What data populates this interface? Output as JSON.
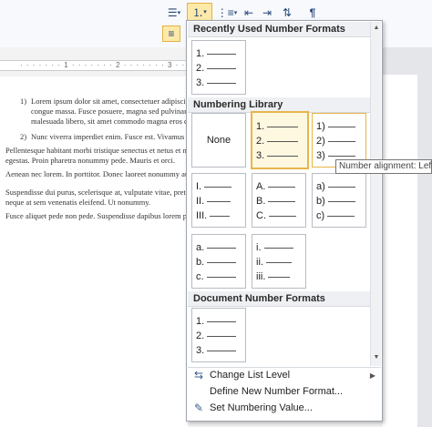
{
  "ribbon": {
    "bullets_icon": "bullets-icon",
    "numbering_icon": "numbering-icon",
    "multilevel_icon": "multilevel-icon",
    "decrease_indent_icon": "decrease-indent-icon",
    "increase_indent_icon": "increase-indent-icon",
    "sort_icon": "sort-icon",
    "show_marks_label": "¶"
  },
  "document": {
    "list_items": [
      {
        "num": "1)",
        "text": "Lorem ipsum dolor sit amet, consectetuer adipiscing elit. Maecenas porttitor congue massa. Fusce posuere, magna sed pulvinar ultricies, purus lectus malesuada libero, sit amet commodo magna eros quis urna."
      },
      {
        "num": "2)",
        "text": "Nunc viverra imperdiet enim. Fusce est. Vivamus a tellus."
      }
    ],
    "paragraphs": [
      "Pellentesque habitant morbi tristique senectus et netus et malesuada fames ac turpis egestas. Proin pharetra nonummy pede. Mauris et orci.",
      "Aenean nec lorem. In porttitor. Donec laoreet nonummy augue.",
      "Suspendisse dui purus, scelerisque at, vulputate vitae, pretium mattis, nunc. Mauris eget neque at sem venenatis eleifend. Ut nonummy.",
      "Fusce aliquet pede non pede. Suspendisse dapibus lorem pellentesque magna."
    ]
  },
  "menu": {
    "recent_header": "Recently Used Number Formats",
    "library_header": "Numbering Library",
    "document_header": "Document Number Formats",
    "recent_formats": [
      [
        "1.",
        "2.",
        "3."
      ]
    ],
    "library_formats": [
      {
        "label": "None"
      },
      {
        "items": [
          "1.",
          "2.",
          "3."
        ]
      },
      {
        "items": [
          "1)",
          "2)",
          "3)"
        ]
      },
      {
        "items": [
          "I.",
          "II.",
          "III."
        ]
      },
      {
        "items": [
          "A.",
          "B.",
          "C."
        ]
      },
      {
        "items": [
          "a)",
          "b)",
          "c)"
        ]
      },
      {
        "items": [
          "a.",
          "b.",
          "c."
        ]
      },
      {
        "items": [
          "i.",
          "ii.",
          "iii."
        ]
      }
    ],
    "document_formats": [
      [
        "1.",
        "2.",
        "3."
      ]
    ],
    "commands": [
      {
        "label": "Change List Level",
        "icon": "change-list-level-icon",
        "has_submenu": true
      },
      {
        "label": "Define New Number Format...",
        "icon": "",
        "has_submenu": false
      },
      {
        "label": "Set Numbering Value...",
        "icon": "set-numbering-value-icon",
        "has_submenu": false
      }
    ]
  },
  "tooltip": {
    "text": "Number alignment: Left"
  }
}
